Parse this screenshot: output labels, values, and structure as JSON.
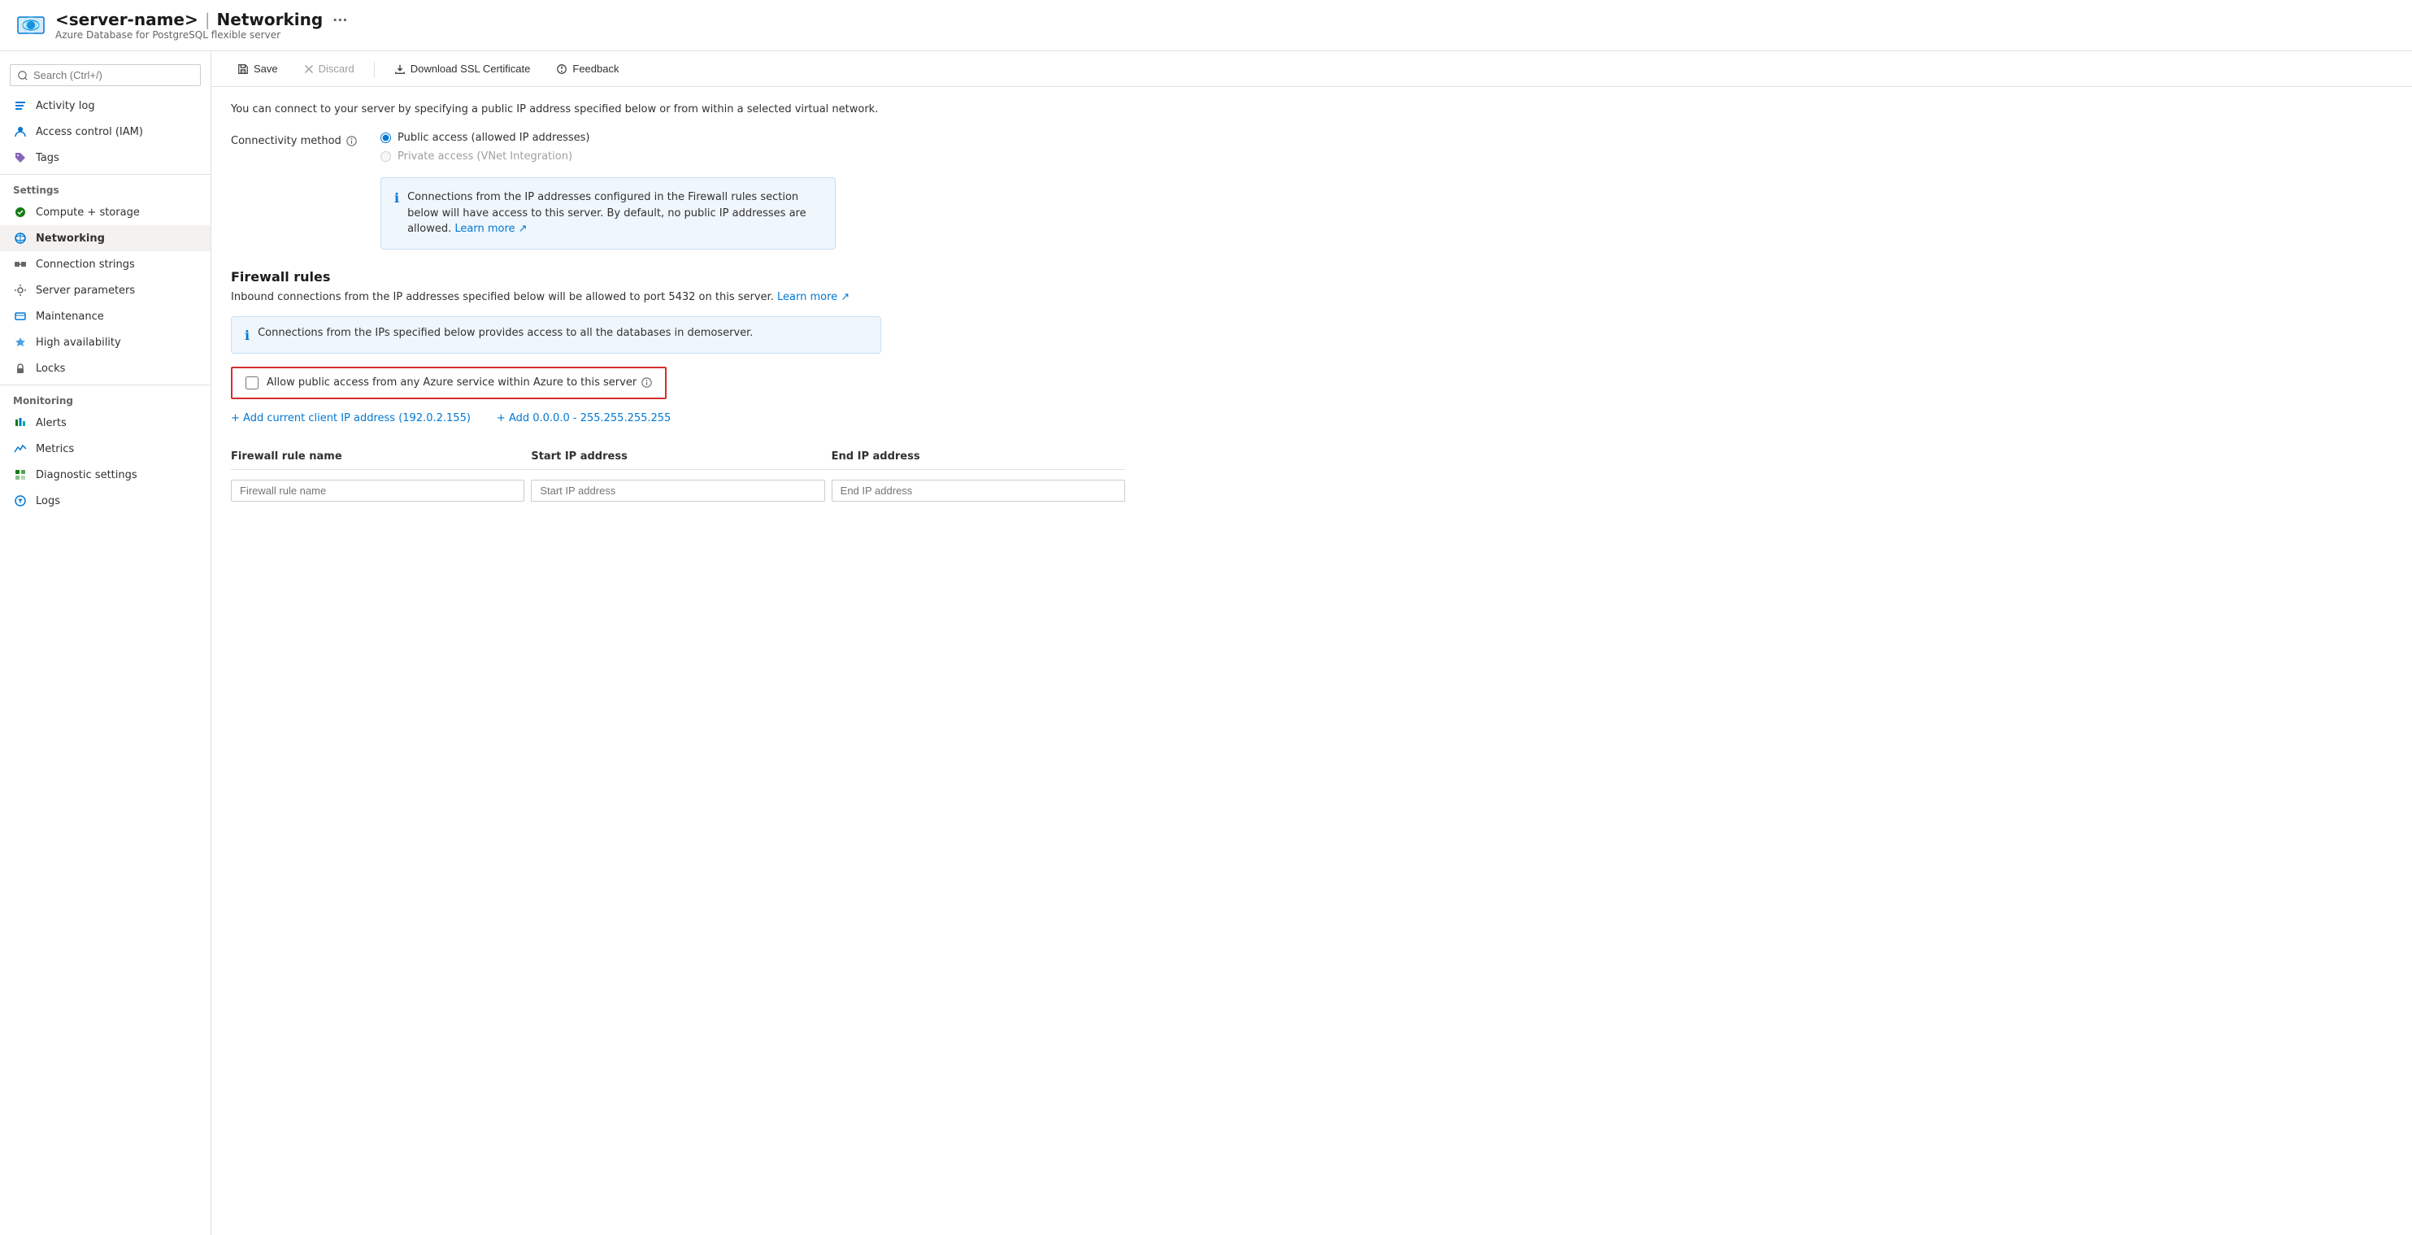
{
  "header": {
    "server_name": "<server-name>",
    "page_title": "Networking",
    "subtitle": "Azure Database for PostgreSQL flexible server",
    "ellipsis": "···"
  },
  "toolbar": {
    "save_label": "Save",
    "discard_label": "Discard",
    "download_ssl_label": "Download SSL Certificate",
    "feedback_label": "Feedback"
  },
  "sidebar": {
    "search_placeholder": "Search (Ctrl+/)",
    "items_top": [
      {
        "id": "activity-log",
        "label": "Activity log",
        "icon": "log"
      },
      {
        "id": "access-control",
        "label": "Access control (IAM)",
        "icon": "iam"
      },
      {
        "id": "tags",
        "label": "Tags",
        "icon": "tags"
      }
    ],
    "settings_label": "Settings",
    "settings_items": [
      {
        "id": "compute-storage",
        "label": "Compute + storage",
        "icon": "compute"
      },
      {
        "id": "networking",
        "label": "Networking",
        "icon": "network",
        "active": true
      },
      {
        "id": "connection-strings",
        "label": "Connection strings",
        "icon": "connection"
      },
      {
        "id": "server-parameters",
        "label": "Server parameters",
        "icon": "params"
      },
      {
        "id": "maintenance",
        "label": "Maintenance",
        "icon": "maintenance"
      },
      {
        "id": "high-availability",
        "label": "High availability",
        "icon": "ha"
      },
      {
        "id": "locks",
        "label": "Locks",
        "icon": "locks"
      }
    ],
    "monitoring_label": "Monitoring",
    "monitoring_items": [
      {
        "id": "alerts",
        "label": "Alerts",
        "icon": "alerts"
      },
      {
        "id": "metrics",
        "label": "Metrics",
        "icon": "metrics"
      },
      {
        "id": "diagnostic-settings",
        "label": "Diagnostic settings",
        "icon": "diagnostics"
      },
      {
        "id": "logs",
        "label": "Logs",
        "icon": "logs"
      }
    ]
  },
  "content": {
    "intro_text": "You can connect to your server by specifying a public IP address specified below or from within a selected virtual network.",
    "connectivity_label": "Connectivity method",
    "connectivity_options": [
      {
        "id": "public",
        "label": "Public access (allowed IP addresses)",
        "checked": true,
        "disabled": false
      },
      {
        "id": "private",
        "label": "Private access (VNet Integration)",
        "checked": false,
        "disabled": true
      }
    ],
    "info_box_text": "Connections from the IP addresses configured in the Firewall rules section below will have access to this server. By default, no public IP addresses are allowed.",
    "info_box_link": "Learn more",
    "firewall_title": "Firewall rules",
    "firewall_desc": "Inbound connections from the IP addresses specified below will be allowed to port 5432 on this server.",
    "firewall_learn_more": "Learn more",
    "firewall_info": "Connections from the IPs specified below provides access to all the databases in demoserver.",
    "checkbox_label": "Allow public access from any Azure service within Azure to this server",
    "add_current_ip": "+ Add current client IP address (192.0.2.155)",
    "add_all_ips": "+ Add 0.0.0.0 - 255.255.255.255",
    "table_headers": {
      "rule_name": "Firewall rule name",
      "start_ip": "Start IP address",
      "end_ip": "End IP address"
    },
    "table_placeholders": {
      "rule_name": "Firewall rule name",
      "start_ip": "Start IP address",
      "end_ip": "End IP address"
    }
  }
}
